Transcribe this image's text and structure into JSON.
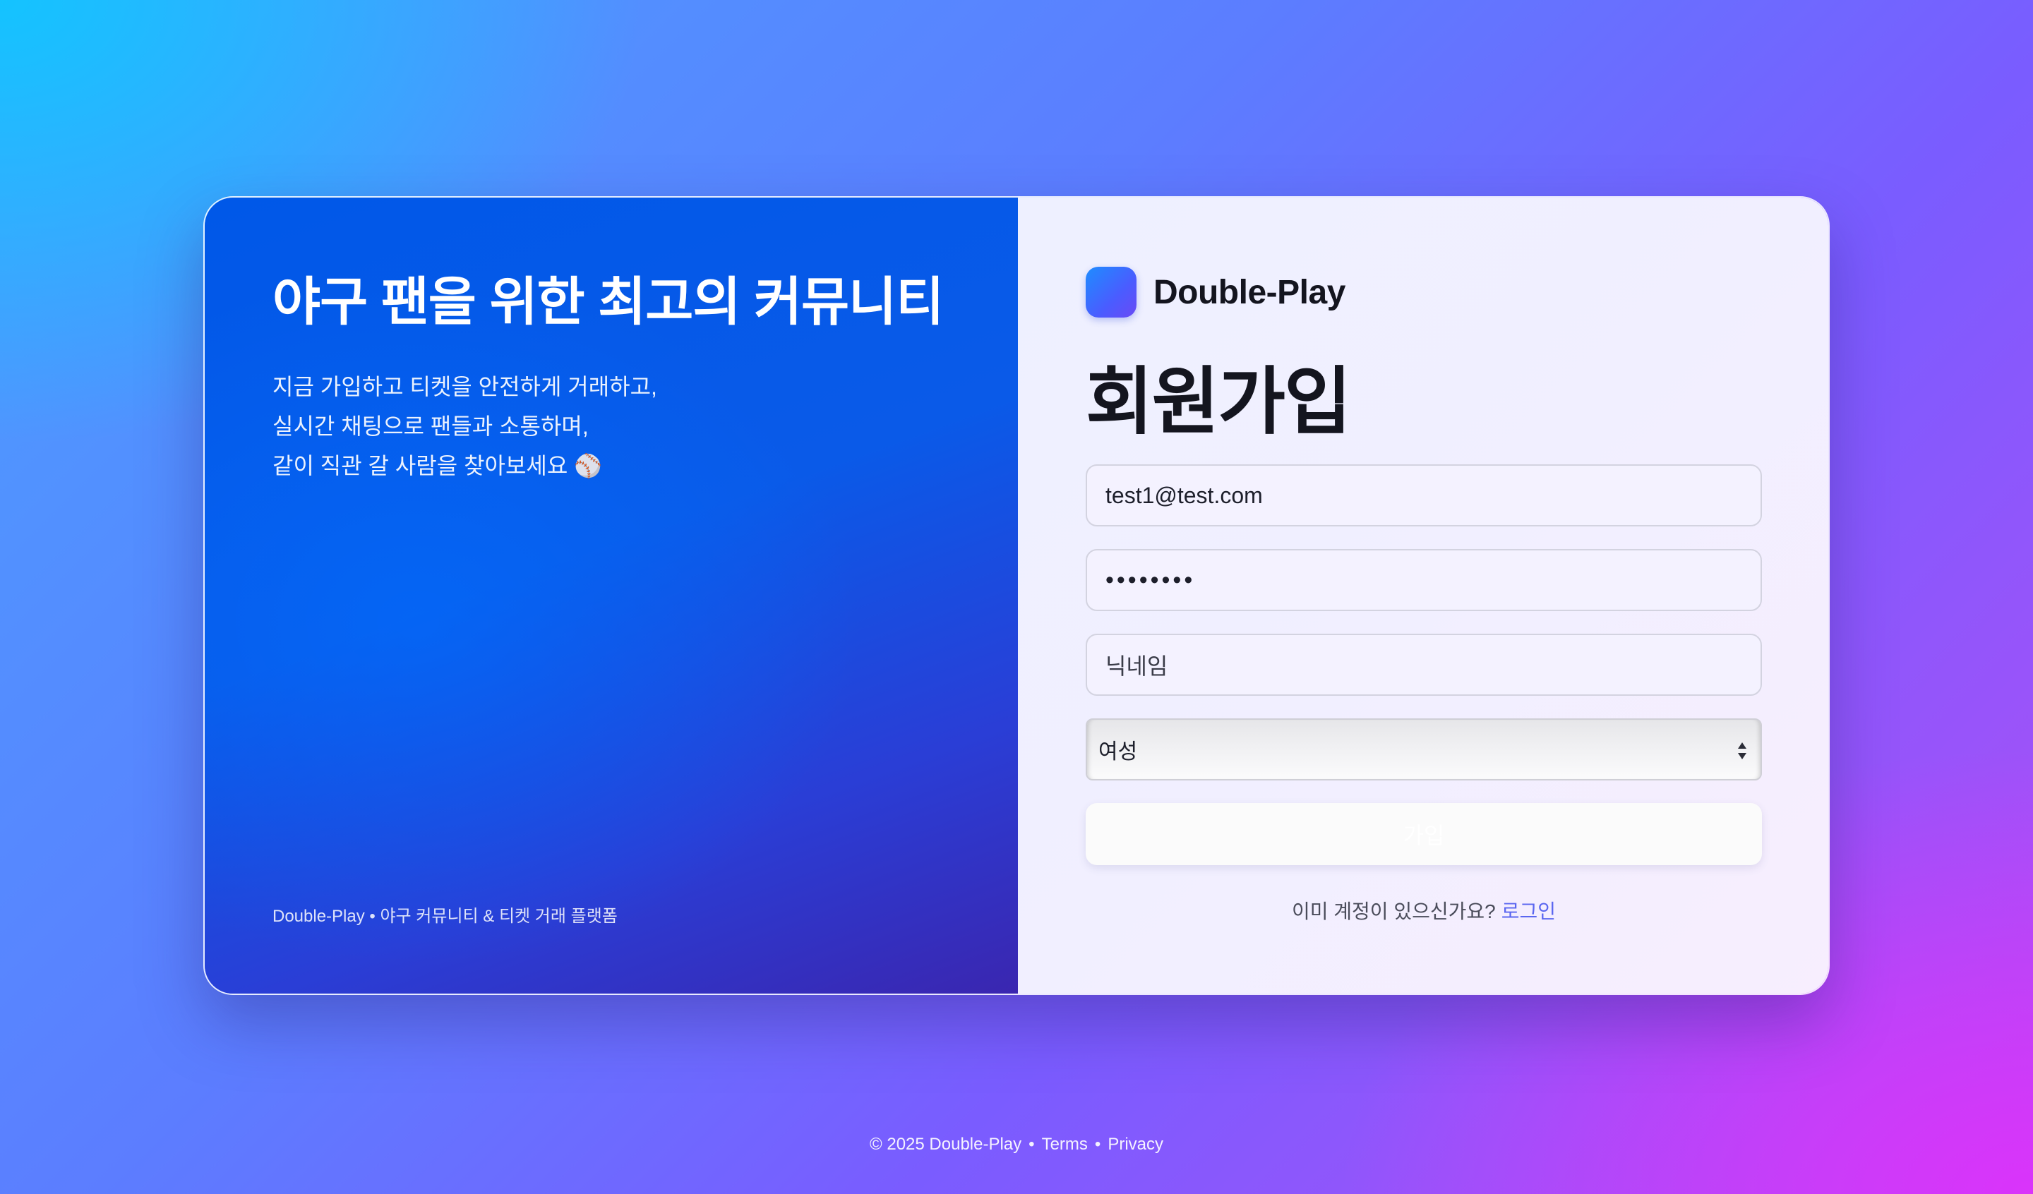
{
  "left_panel": {
    "headline": "야구 팬을 위한 최고의 커뮤니티",
    "description_lines": [
      "지금 가입하고 티켓을 안전하게 거래하고,",
      "실시간 채팅으로 팬들과 소통하며,",
      "같이 직관 갈 사람을 찾아보세요 ⚾"
    ],
    "footer_note": "Double-Play • 야구 커뮤니티 & 티켓 거래 플랫폼"
  },
  "brand": {
    "name": "Double-Play"
  },
  "form": {
    "title": "회원가입",
    "email_value": "test1@test.com",
    "password_value": "••••••••",
    "nickname_placeholder": "닉네임",
    "gender_selected": "여성",
    "submit_label": "가입"
  },
  "login_prompt": {
    "text": "이미 계정이 있으신가요?",
    "link": "로그인"
  },
  "page_footer": {
    "copyright": "© 2025 Double-Play",
    "terms": "Terms",
    "privacy": "Privacy",
    "separator": "•"
  },
  "icons": {
    "logo": "double-play-logo",
    "select_arrows": "up-down-arrows-icon"
  },
  "colors": {
    "left_panel": "#0a5ae8",
    "accent_link": "#5a66f0",
    "title_text": "#14151f"
  }
}
